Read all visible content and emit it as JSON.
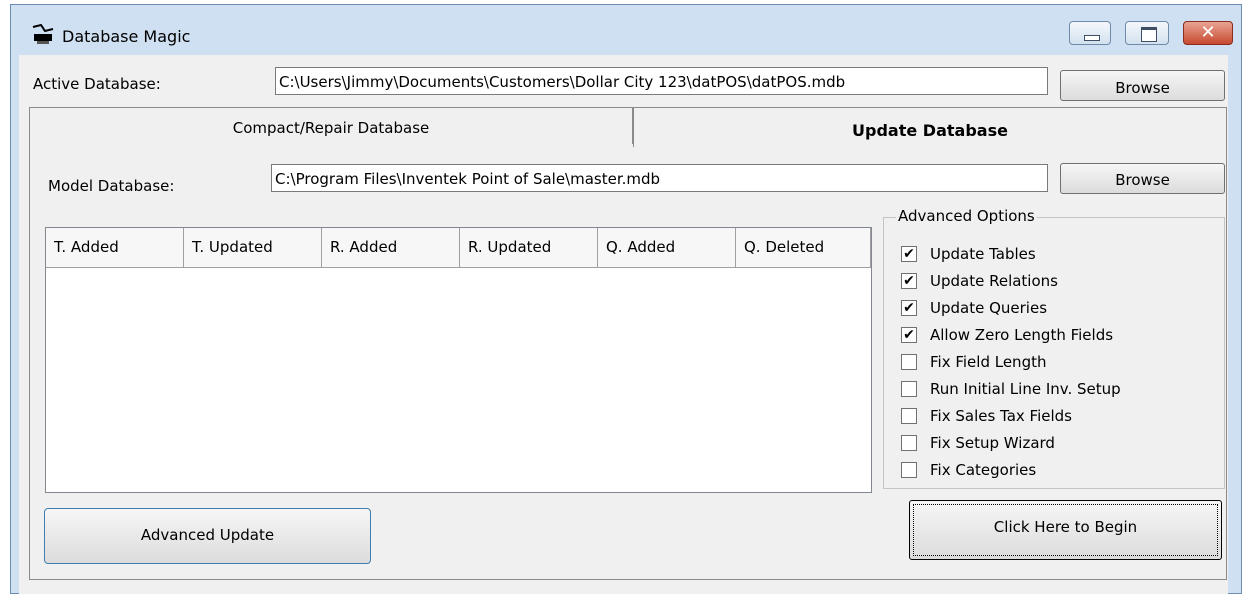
{
  "window": {
    "title": "Database Magic"
  },
  "active_db": {
    "label": "Active Database:",
    "path": "C:\\Users\\Jimmy\\Documents\\Customers\\Dollar City 123\\datPOS\\datPOS.mdb",
    "browse_label": "Browse"
  },
  "tabs": [
    {
      "label": "Compact/Repair  Database",
      "selected": false
    },
    {
      "label": "Update Database",
      "selected": true
    }
  ],
  "model_db": {
    "label": "Model Database:",
    "path": "C:\\Program Files\\Inventek Point of Sale\\master.mdb",
    "browse_label": "Browse"
  },
  "table": {
    "columns": [
      "T. Added",
      "T. Updated",
      "R. Added",
      "R. Updated",
      "Q. Added",
      "Q. Deleted"
    ],
    "rows": []
  },
  "advanced_options": {
    "title": "Advanced Options",
    "options": [
      {
        "label": "Update Tables",
        "checked": true
      },
      {
        "label": "Update Relations",
        "checked": true
      },
      {
        "label": "Update Queries",
        "checked": true
      },
      {
        "label": "Allow Zero Length Fields",
        "checked": true
      },
      {
        "label": "Fix Field Length",
        "checked": false
      },
      {
        "label": "Run Initial Line Inv. Setup",
        "checked": false
      },
      {
        "label": "Fix Sales Tax Fields",
        "checked": false
      },
      {
        "label": "Fix Setup Wizard",
        "checked": false
      },
      {
        "label": "Fix Categories",
        "checked": false
      }
    ]
  },
  "buttons": {
    "advanced_update": "Advanced Update",
    "begin": "Click Here to Begin"
  },
  "colors": {
    "window_frame": "#cfe0f2",
    "client_bg": "#f0f0f0",
    "close_button": "#c84a31"
  }
}
